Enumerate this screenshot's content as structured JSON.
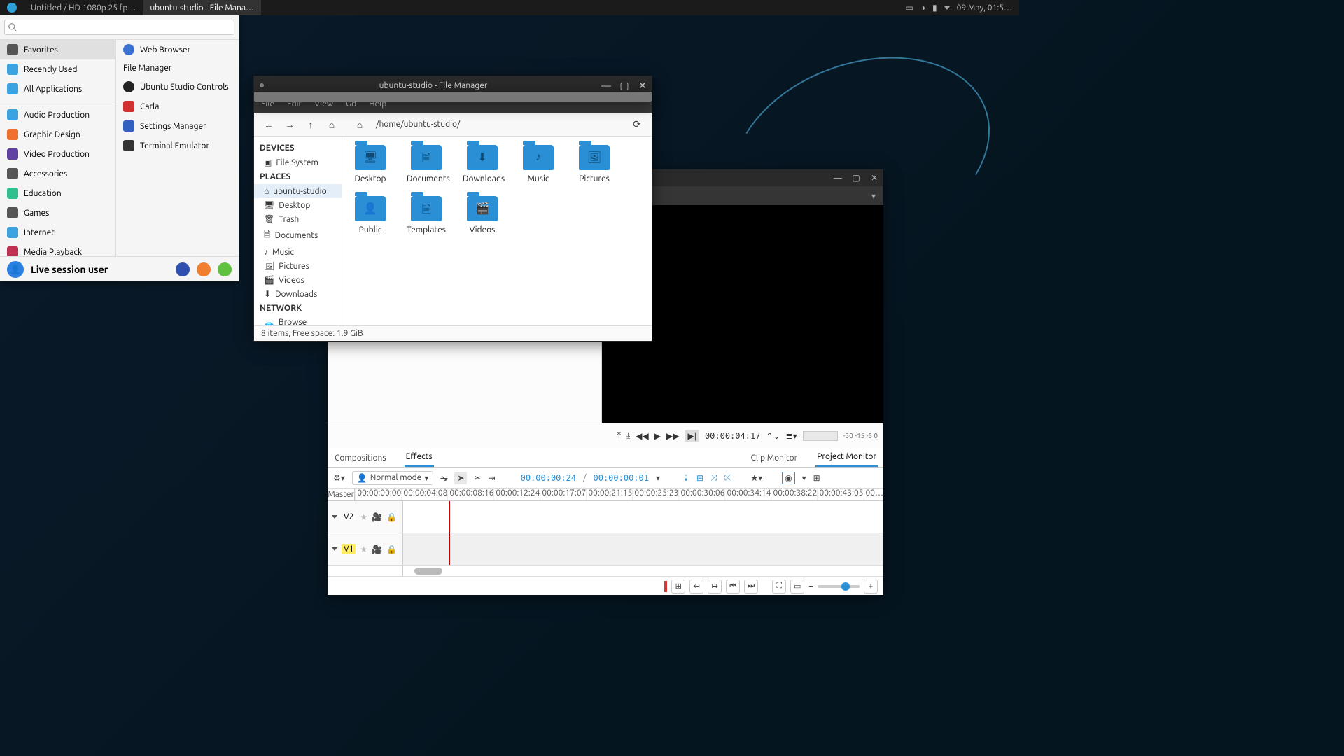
{
  "panel": {
    "task1": "Untitled / HD 1080p 25 fp…",
    "task2": "ubuntu-studio - File Mana…",
    "clock": "09 May, 01:5…"
  },
  "menu": {
    "search_placeholder": "",
    "cats": [
      {
        "label": "Favorites"
      },
      {
        "label": "Recently Used"
      },
      {
        "label": "All Applications"
      },
      {
        "label": "Audio Production"
      },
      {
        "label": "Graphic Design"
      },
      {
        "label": "Video Production"
      },
      {
        "label": "Accessories"
      },
      {
        "label": "Education"
      },
      {
        "label": "Games"
      },
      {
        "label": "Internet"
      },
      {
        "label": "Media Playback"
      }
    ],
    "apps": [
      {
        "label": "Web Browser"
      },
      {
        "label": "File Manager"
      },
      {
        "label": "Ubuntu Studio Controls"
      },
      {
        "label": "Carla"
      },
      {
        "label": "Settings Manager"
      },
      {
        "label": "Terminal Emulator"
      }
    ],
    "user": "Live session user"
  },
  "fm": {
    "title": "ubuntu-studio - File Manager",
    "menus": [
      "File",
      "Edit",
      "View",
      "Go",
      "Help"
    ],
    "path": "/home/ubuntu-studio/",
    "devices_hdr": "DEVICES",
    "places_hdr": "PLACES",
    "network_hdr": "NETWORK",
    "devices": [
      "File System"
    ],
    "places": [
      "ubuntu-studio",
      "Desktop",
      "Trash",
      "Documents",
      "Music",
      "Pictures",
      "Videos",
      "Downloads"
    ],
    "network": [
      "Browse Network"
    ],
    "folders": [
      {
        "label": "Desktop",
        "glyph": "🖥"
      },
      {
        "label": "Documents",
        "glyph": "🗎"
      },
      {
        "label": "Downloads",
        "glyph": "⬇"
      },
      {
        "label": "Music",
        "glyph": "♪"
      },
      {
        "label": "Pictures",
        "glyph": "🖼"
      },
      {
        "label": "Public",
        "glyph": "👤"
      },
      {
        "label": "Templates",
        "glyph": "🗎"
      },
      {
        "label": "Videos",
        "glyph": "🎬"
      }
    ],
    "status": "8 items, Free space: 1.9 GiB"
  },
  "kd": {
    "tabs_left": [
      "Compositions",
      "Effects"
    ],
    "tabs_right": [
      "Clip Monitor",
      "Project Monitor"
    ],
    "mode": "Normal mode",
    "time_pos": "00:00:00:24",
    "time_dur": "00:00:00:01",
    "monitor_time": "00:00:04:17",
    "meter_ticks": "-30  -15   -5   0",
    "master": "Master",
    "ticks": [
      "00:00:00:00",
      "00:00:04:08",
      "00:00:08:16",
      "00:00:12:24",
      "00:00:17:07",
      "00:00:21:15",
      "00:00:25:23",
      "00:00:30:06",
      "00:00:34:14",
      "00:00:38:22",
      "00:00:43:05",
      "00…"
    ],
    "tracks": [
      {
        "name": "V2",
        "hl": false
      },
      {
        "name": "V1",
        "hl": true
      }
    ]
  }
}
